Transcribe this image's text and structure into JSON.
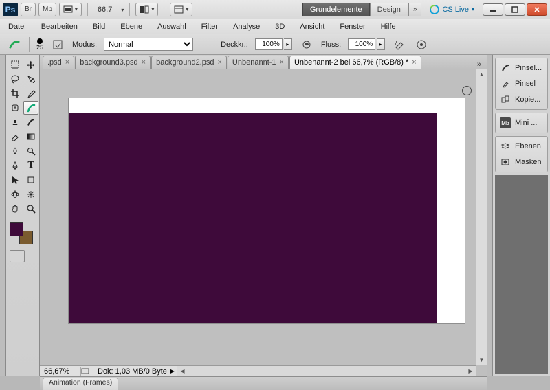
{
  "titlebar": {
    "br": "Br",
    "mb": "Mb",
    "zoom": "66,7",
    "workspace": {
      "active": "Grundelemente",
      "other": "Design",
      "more": "»"
    },
    "cslive": "CS Live"
  },
  "menu": [
    "Datei",
    "Bearbeiten",
    "Bild",
    "Ebene",
    "Auswahl",
    "Filter",
    "Analyse",
    "3D",
    "Ansicht",
    "Fenster",
    "Hilfe"
  ],
  "optbar": {
    "brush_size": "25",
    "mode_label": "Modus:",
    "mode_value": "Normal",
    "opacity_label": "Deckkr.:",
    "opacity_value": "100%",
    "flow_label": "Fluss:",
    "flow_value": "100%"
  },
  "doctabs": [
    {
      "label": ".psd"
    },
    {
      "label": "background3.psd"
    },
    {
      "label": "background2.psd"
    },
    {
      "label": "Unbenannt-1"
    },
    {
      "label": "Unbenannt-2 bei 66,7% (RGB/8) *",
      "active": true
    }
  ],
  "doctabs_more": "»",
  "status": {
    "zoom": "66,67%",
    "doc": "Dok: 1,03 MB/0 Byte"
  },
  "panels": {
    "g1": [
      {
        "icon": "brush-presets-icon",
        "label": "Pinsel..."
      },
      {
        "icon": "brush-icon",
        "label": "Pinsel"
      },
      {
        "icon": "clone-source-icon",
        "label": "Kopie..."
      }
    ],
    "g2": [
      {
        "icon": "mini-bridge-icon",
        "label": "Mini ..."
      }
    ],
    "g3": [
      {
        "icon": "layers-icon",
        "label": "Ebenen"
      },
      {
        "icon": "masks-icon",
        "label": "Masken"
      }
    ]
  },
  "bottom_tab": "Animation (Frames)",
  "colors": {
    "canvas_fill": "#3e0a3a",
    "foreground": "#3e0a3a",
    "background_swatch": "#7a5b2f"
  }
}
